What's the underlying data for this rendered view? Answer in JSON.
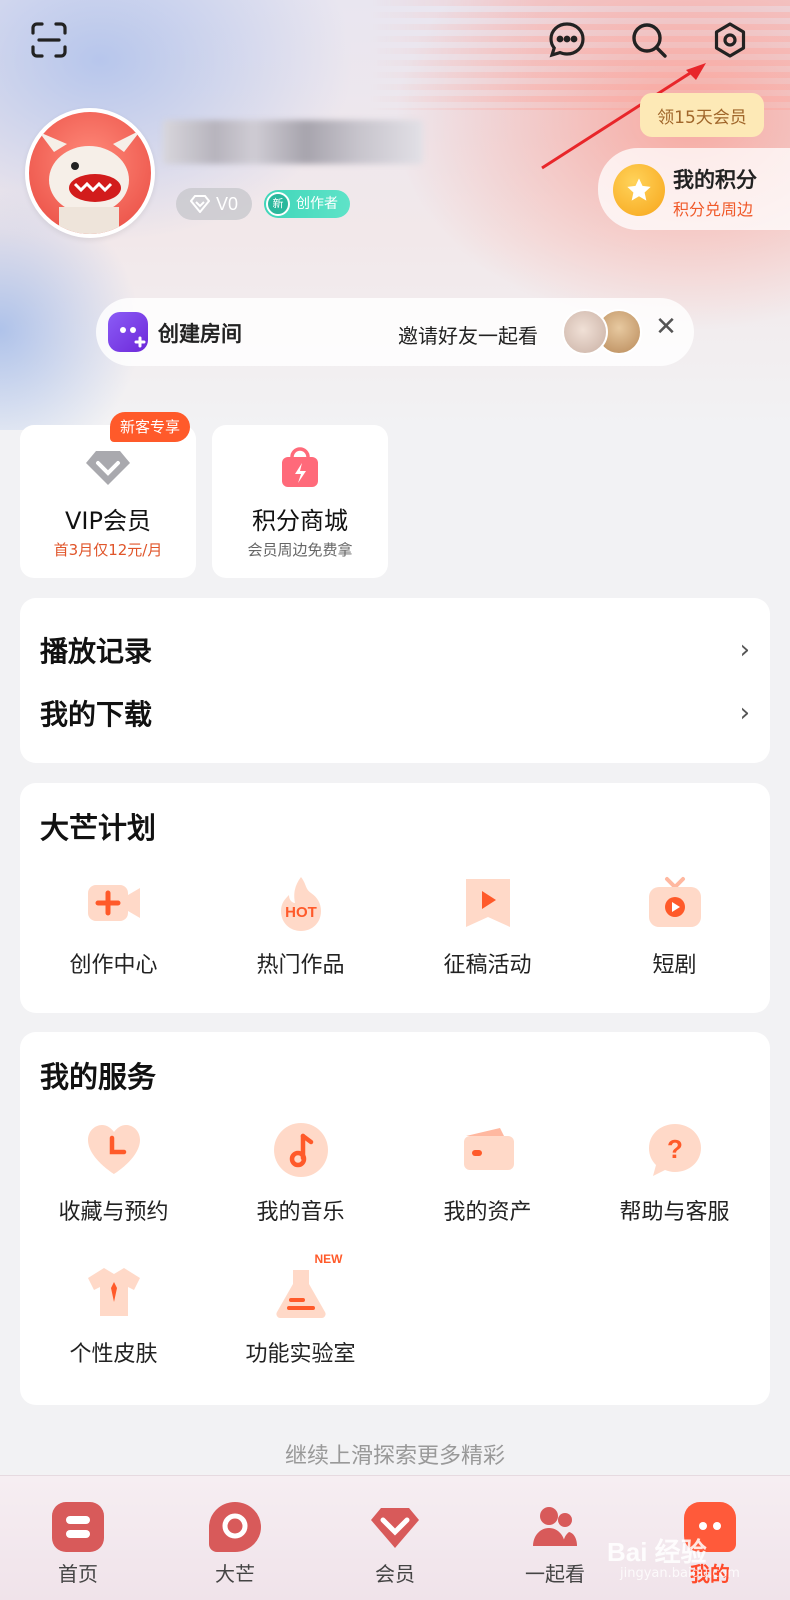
{
  "header": {
    "icons": [
      "scan-icon",
      "message-icon",
      "search-icon",
      "settings-icon"
    ]
  },
  "profile": {
    "level": "V0",
    "creator_badge_new": "新",
    "creator_badge_label": "创作者",
    "vip_tip": "领15天会员",
    "points_title": "我的积分",
    "points_sub": "积分兑周边"
  },
  "room": {
    "label": "创建房间",
    "invite": "邀请好友一起看",
    "close": "✕"
  },
  "quick": {
    "vip_tag": "新客专享",
    "vip_title": "VIP会员",
    "vip_sub": "首3月仅12元/月",
    "mall_title": "积分商城",
    "mall_sub": "会员周边免费拿"
  },
  "history": {
    "items": [
      {
        "label": "播放记录",
        "chevron": "›"
      },
      {
        "label": "我的下载",
        "chevron": "›"
      }
    ]
  },
  "plan": {
    "title": "大芒计划",
    "items": [
      {
        "label": "创作中心",
        "icon": "video-camera-icon"
      },
      {
        "label": "热门作品",
        "icon": "hot-flame-icon"
      },
      {
        "label": "征稿活动",
        "icon": "play-bookmark-icon"
      },
      {
        "label": "短剧",
        "icon": "tv-play-icon"
      }
    ]
  },
  "services": {
    "title": "我的服务",
    "items": [
      {
        "label": "收藏与预约",
        "icon": "heart-clock-icon"
      },
      {
        "label": "我的音乐",
        "icon": "music-note-icon"
      },
      {
        "label": "我的资产",
        "icon": "wallet-icon"
      },
      {
        "label": "帮助与客服",
        "icon": "help-bubble-icon"
      },
      {
        "label": "个性皮肤",
        "icon": "tshirt-icon"
      },
      {
        "label": "功能实验室",
        "icon": "flask-icon",
        "badge": "NEW"
      }
    ]
  },
  "footer_hint": "继续上滑探索更多精彩",
  "tabbar": {
    "tabs": [
      {
        "label": "首页",
        "icon": "home-icon"
      },
      {
        "label": "大芒",
        "icon": "damang-icon"
      },
      {
        "label": "会员",
        "icon": "vip-diamond-icon"
      },
      {
        "label": "一起看",
        "icon": "watch-together-icon"
      },
      {
        "label": "我的",
        "icon": "mine-icon",
        "active": true
      }
    ]
  },
  "watermark": {
    "main": "Bai 经验",
    "sub": "jingyan.baidu.com"
  },
  "colors": {
    "accent": "#ff4a2a",
    "icon_orange": "#ff6a3d",
    "icon_peach": "#ffd9c8"
  }
}
